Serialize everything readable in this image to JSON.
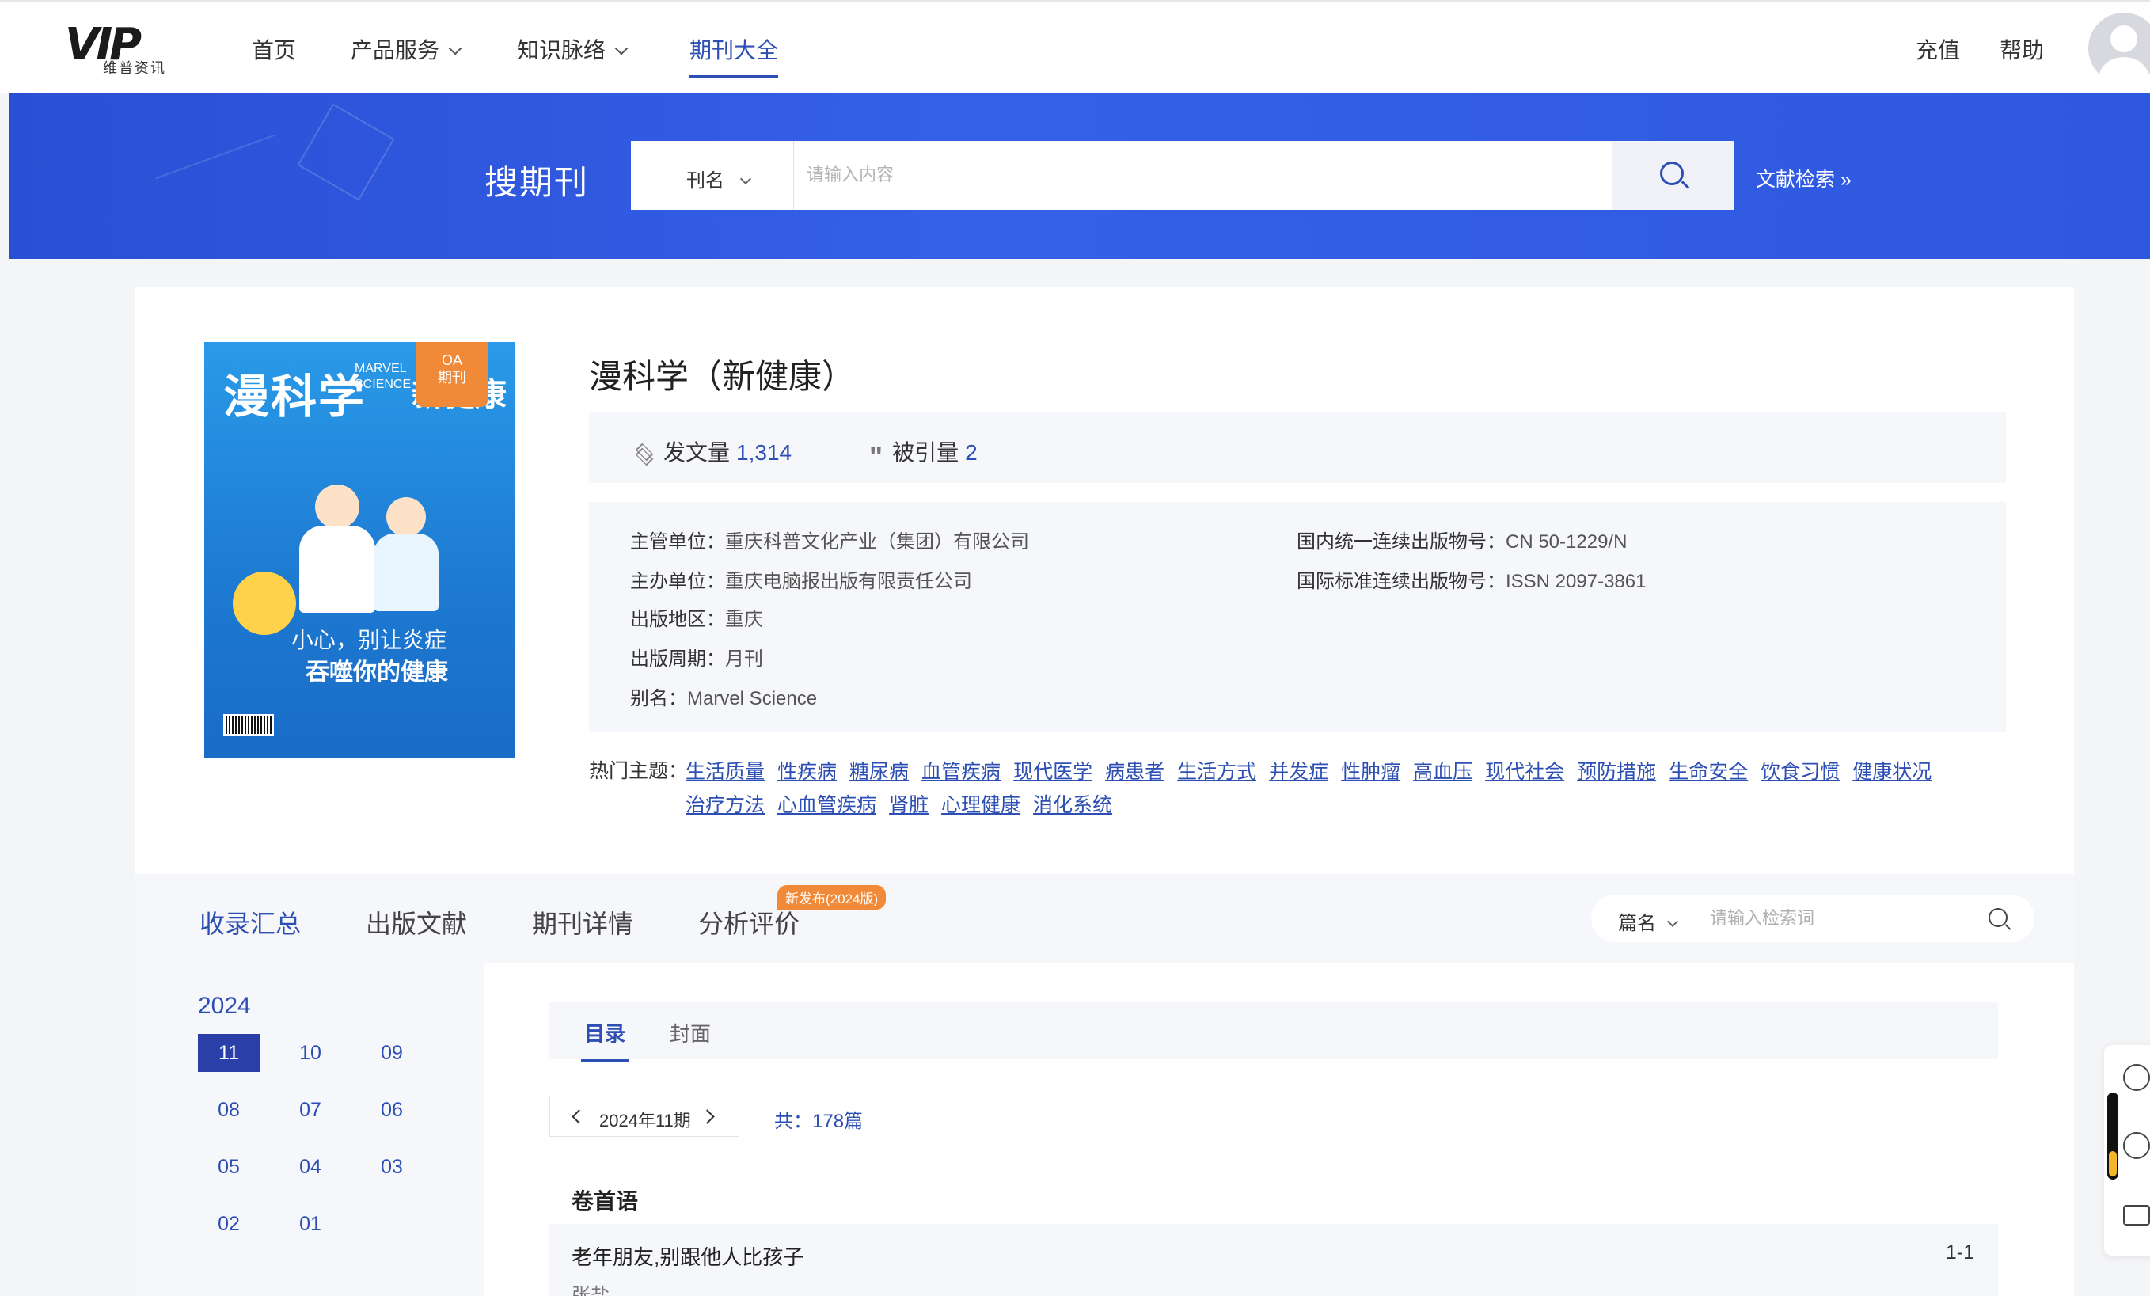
{
  "nav": {
    "logo_text": "VIP",
    "logo_sub": "维普资讯",
    "items": [
      {
        "label": "首页"
      },
      {
        "label": "产品服务"
      },
      {
        "label": "知识脉络"
      },
      {
        "label": "期刊大全"
      }
    ],
    "recharge": "充值",
    "help": "帮助"
  },
  "hero": {
    "title": "搜期刊",
    "search_field": "刊名",
    "search_placeholder": "请输入内容",
    "advanced_link": "文献检索 »"
  },
  "journal": {
    "cover": {
      "title": "漫科学",
      "subtitle_en": "MARVEL SCIENCE",
      "subtitle_cn": "新健康",
      "badge_oa": "OA",
      "badge_label": "期刊",
      "headline_1": "小心，别让炎症",
      "headline_2": "吞噬你的健康"
    },
    "title": "漫科学（新健康）",
    "articles_label": "发文量",
    "articles_count": "1,314",
    "cited_label": "被引量",
    "cited_count": "2",
    "meta": {
      "supervisor_k": "主管单位：",
      "supervisor_v": "重庆科普文化产业（集团）有限公司",
      "sponsor_k": "主办单位：",
      "sponsor_v": "重庆电脑报出版有限责任公司",
      "region_k": "出版地区：",
      "region_v": "重庆",
      "period_k": "出版周期：",
      "period_v": "月刊",
      "alias_k": "别名：",
      "alias_v": "Marvel Science",
      "cn_k": "国内统一连续出版物号：",
      "cn_v": "CN 50-1229/N",
      "issn_k": "国际标准连续出版物号：",
      "issn_v": "ISSN 2097-3861"
    },
    "hot_label": "热门主题：",
    "hot_tags": [
      "生活质量",
      "性疾病",
      "糖尿病",
      "血管疾病",
      "现代医学",
      "病患者",
      "生活方式",
      "并发症",
      "性肿瘤",
      "高血压",
      "现代社会",
      "预防措施",
      "生命安全",
      "饮食习惯",
      "健康状况",
      "治疗方法",
      "心血管疾病",
      "肾脏",
      "心理健康",
      "消化系统"
    ]
  },
  "tabs": {
    "items": [
      {
        "label": "收录汇总"
      },
      {
        "label": "出版文献"
      },
      {
        "label": "期刊详情"
      },
      {
        "label": "分析评价"
      }
    ],
    "new_badge": "新发布(2024版)",
    "search_field": "篇名",
    "search_placeholder": "请输入检索词"
  },
  "years": {
    "year": "2024",
    "months": [
      "11",
      "10",
      "09",
      "08",
      "07",
      "06",
      "05",
      "04",
      "03",
      "02",
      "01"
    ]
  },
  "content": {
    "subtabs": [
      {
        "label": "目录"
      },
      {
        "label": "封面"
      }
    ],
    "issue": "2024年11期",
    "total": "共：178篇",
    "section": "卷首语",
    "article_title": "老年朋友,别跟他人比孩子",
    "article_pages": "1-1",
    "article_author": "张盐"
  },
  "colors": {
    "primary": "#2d4fb4",
    "hero": "#3460e8",
    "badge": "#f08a38",
    "panel": "#f6f7fa"
  }
}
